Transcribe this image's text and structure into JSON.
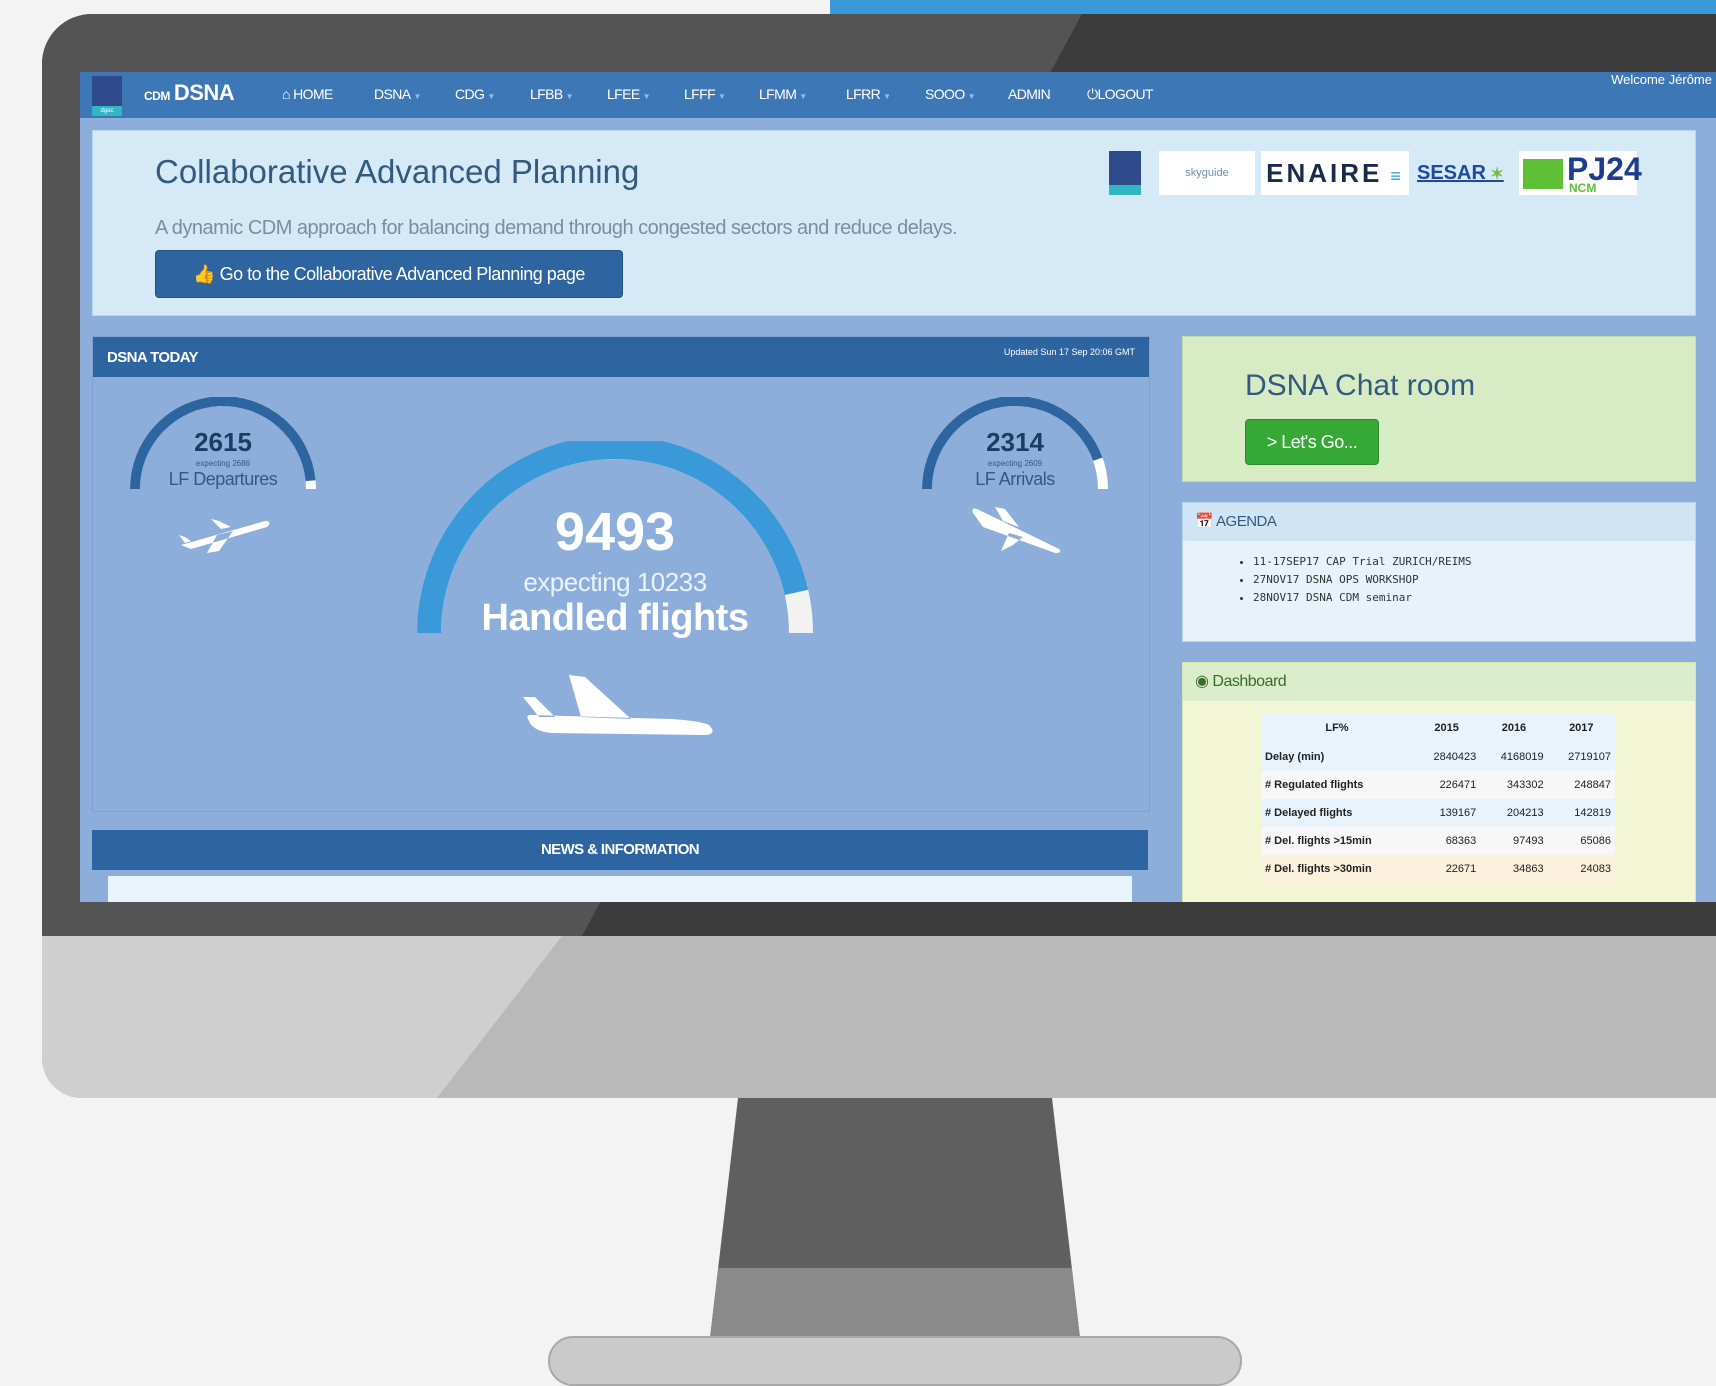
{
  "navbar": {
    "brand_small": "CDM",
    "brand_name": "DSNA",
    "logo_text": "dgac",
    "items": [
      {
        "label": "HOME",
        "icon": "home-icon"
      },
      {
        "label": "DSNA"
      },
      {
        "label": "CDG"
      },
      {
        "label": "LFBB"
      },
      {
        "label": "LFEE"
      },
      {
        "label": "LFFF"
      },
      {
        "label": "LFMM"
      },
      {
        "label": "LFRR"
      },
      {
        "label": "SOOO"
      },
      {
        "label": "ADMIN"
      },
      {
        "label": "LOGOUT",
        "icon": "power-icon"
      }
    ],
    "welcome": "Welcome Jérôme"
  },
  "jumbotron": {
    "title": "Collaborative Advanced Planning",
    "subtitle": "A dynamic CDM approach for balancing demand through congested sectors and reduce delays.",
    "button_label": "Go to the Collaborative Advanced Planning page",
    "partners": {
      "skyguide": "skyguide",
      "enaire": "ENAIRE",
      "sesar": "SESAR",
      "pj24": "PJ24",
      "pj24_sub": "NCM"
    }
  },
  "today": {
    "title": "DSNA TODAY",
    "updated": "Updated Sun 17 Sep 20:06 GMT",
    "departures": {
      "value": "2615",
      "expecting": "expecting 2686",
      "label": "LF Departures",
      "fraction": 0.97
    },
    "arrivals": {
      "value": "2314",
      "expecting": "expecting 2609",
      "label": "LF Arrivals",
      "fraction": 0.89
    },
    "handled": {
      "value": "9493",
      "expecting": "expecting 10233",
      "label": "Handled flights",
      "fraction": 0.93
    }
  },
  "news": {
    "title": "NEWS & INFORMATION"
  },
  "chat": {
    "title": "DSNA Chat room",
    "button_label": "> Let's Go..."
  },
  "agenda": {
    "title": "AGENDA",
    "items": [
      "11-17SEP17 CAP Trial ZURICH/REIMS",
      "27NOV17 DSNA OPS WORKSHOP",
      "28NOV17 DSNA CDM seminar"
    ]
  },
  "dashboard": {
    "title": "Dashboard",
    "columns": [
      "LF%",
      "2015",
      "2016",
      "2017"
    ],
    "rows": [
      [
        "Delay (min)",
        "2840423",
        "4168019",
        "2719107"
      ],
      [
        "# Regulated flights",
        "226471",
        "343302",
        "248847"
      ],
      [
        "# Delayed flights",
        "139167",
        "204213",
        "142819"
      ],
      [
        "# Del. flights >15min",
        "68363",
        "97493",
        "65086"
      ],
      [
        "# Del. flights >30min",
        "22671",
        "34863",
        "24083"
      ]
    ]
  },
  "colors": {
    "navbar": "#3d77b6",
    "panel_header": "#2e65a0",
    "gauge": "#3a9ad9",
    "screen_bg": "#8daedb",
    "chat_button": "#36a836"
  }
}
